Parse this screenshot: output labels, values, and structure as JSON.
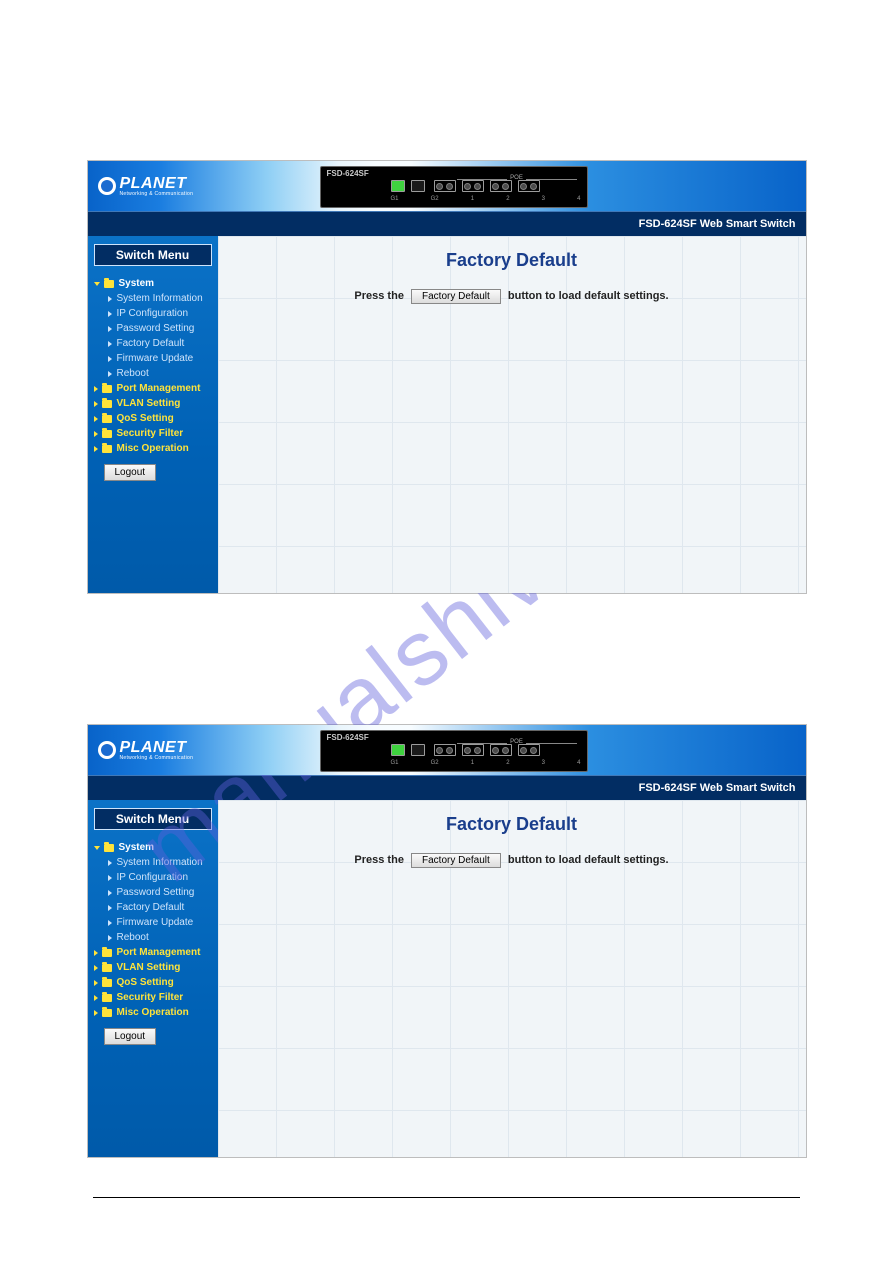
{
  "watermark": "manualshive.com",
  "device": {
    "brand": "PLANET",
    "tagline": "Networking & Communication",
    "model": "FSD-624SF",
    "port_labels": [
      "G1",
      "G2",
      "1",
      "2",
      "3",
      "4"
    ],
    "poe_label": "POE"
  },
  "titlebar": "FSD-624SF Web Smart Switch",
  "sidebar": {
    "title": "Switch Menu",
    "system": {
      "label": "System",
      "items": [
        "System Information",
        "IP Configuration",
        "Password Setting",
        "Factory Default",
        "Firmware Update",
        "Reboot"
      ]
    },
    "others": [
      "Port Management",
      "VLAN Setting",
      "QoS Setting",
      "Security Filter",
      "Misc Operation"
    ],
    "logout": "Logout"
  },
  "content": {
    "heading": "Factory Default",
    "press_pre": "Press the",
    "button_label": "Factory Default",
    "press_post": "button to load default settings."
  }
}
